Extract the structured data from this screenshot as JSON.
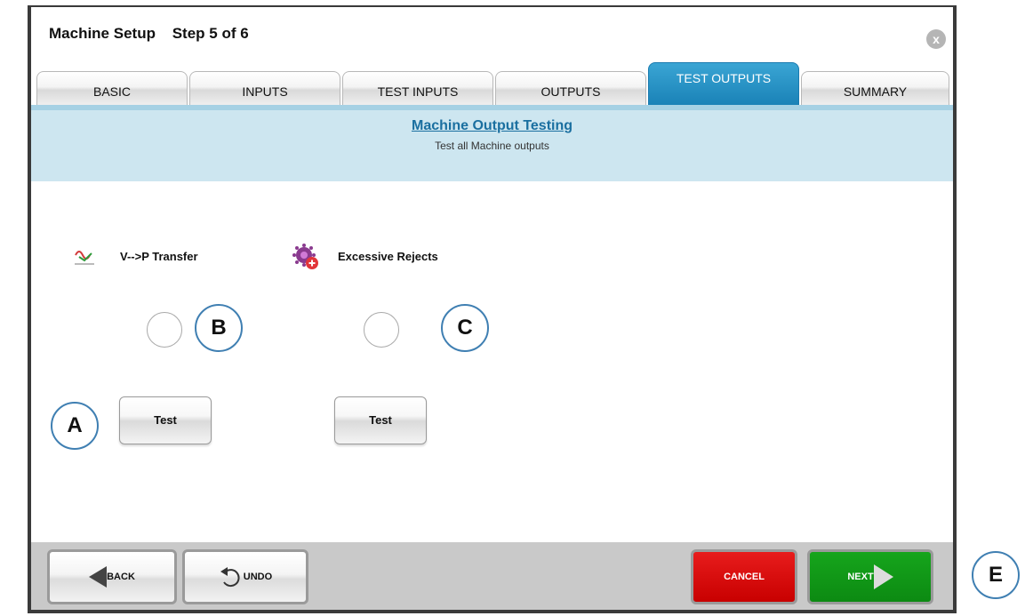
{
  "window": {
    "title": "Machine Setup",
    "step": "Step 5 of 6",
    "close_label": "x"
  },
  "tabs": [
    {
      "label": "BASIC"
    },
    {
      "label": "INPUTS"
    },
    {
      "label": "TEST INPUTS"
    },
    {
      "label": "OUTPUTS"
    },
    {
      "label": "TEST OUTPUTS",
      "active": true
    },
    {
      "label": "SUMMARY"
    }
  ],
  "banner": {
    "title": "Machine Output Testing",
    "subtitle": "Test all Machine outputs"
  },
  "outputs": [
    {
      "label": "V-->P Transfer",
      "icon": "vp-transfer-icon",
      "test_label": "Test"
    },
    {
      "label": "Excessive Rejects",
      "icon": "excessive-rejects-icon",
      "test_label": "Test"
    }
  ],
  "footer": {
    "back_label": "BACK",
    "undo_label": "UNDO",
    "cancel_label": "CANCEL",
    "next_label": "NEXT"
  },
  "callouts": {
    "a": "A",
    "b": "B",
    "c": "C",
    "e": "E"
  },
  "colors": {
    "accent": "#1a82b7",
    "banner": "#cde6f0",
    "cancel": "#d80000",
    "next": "#119016"
  }
}
